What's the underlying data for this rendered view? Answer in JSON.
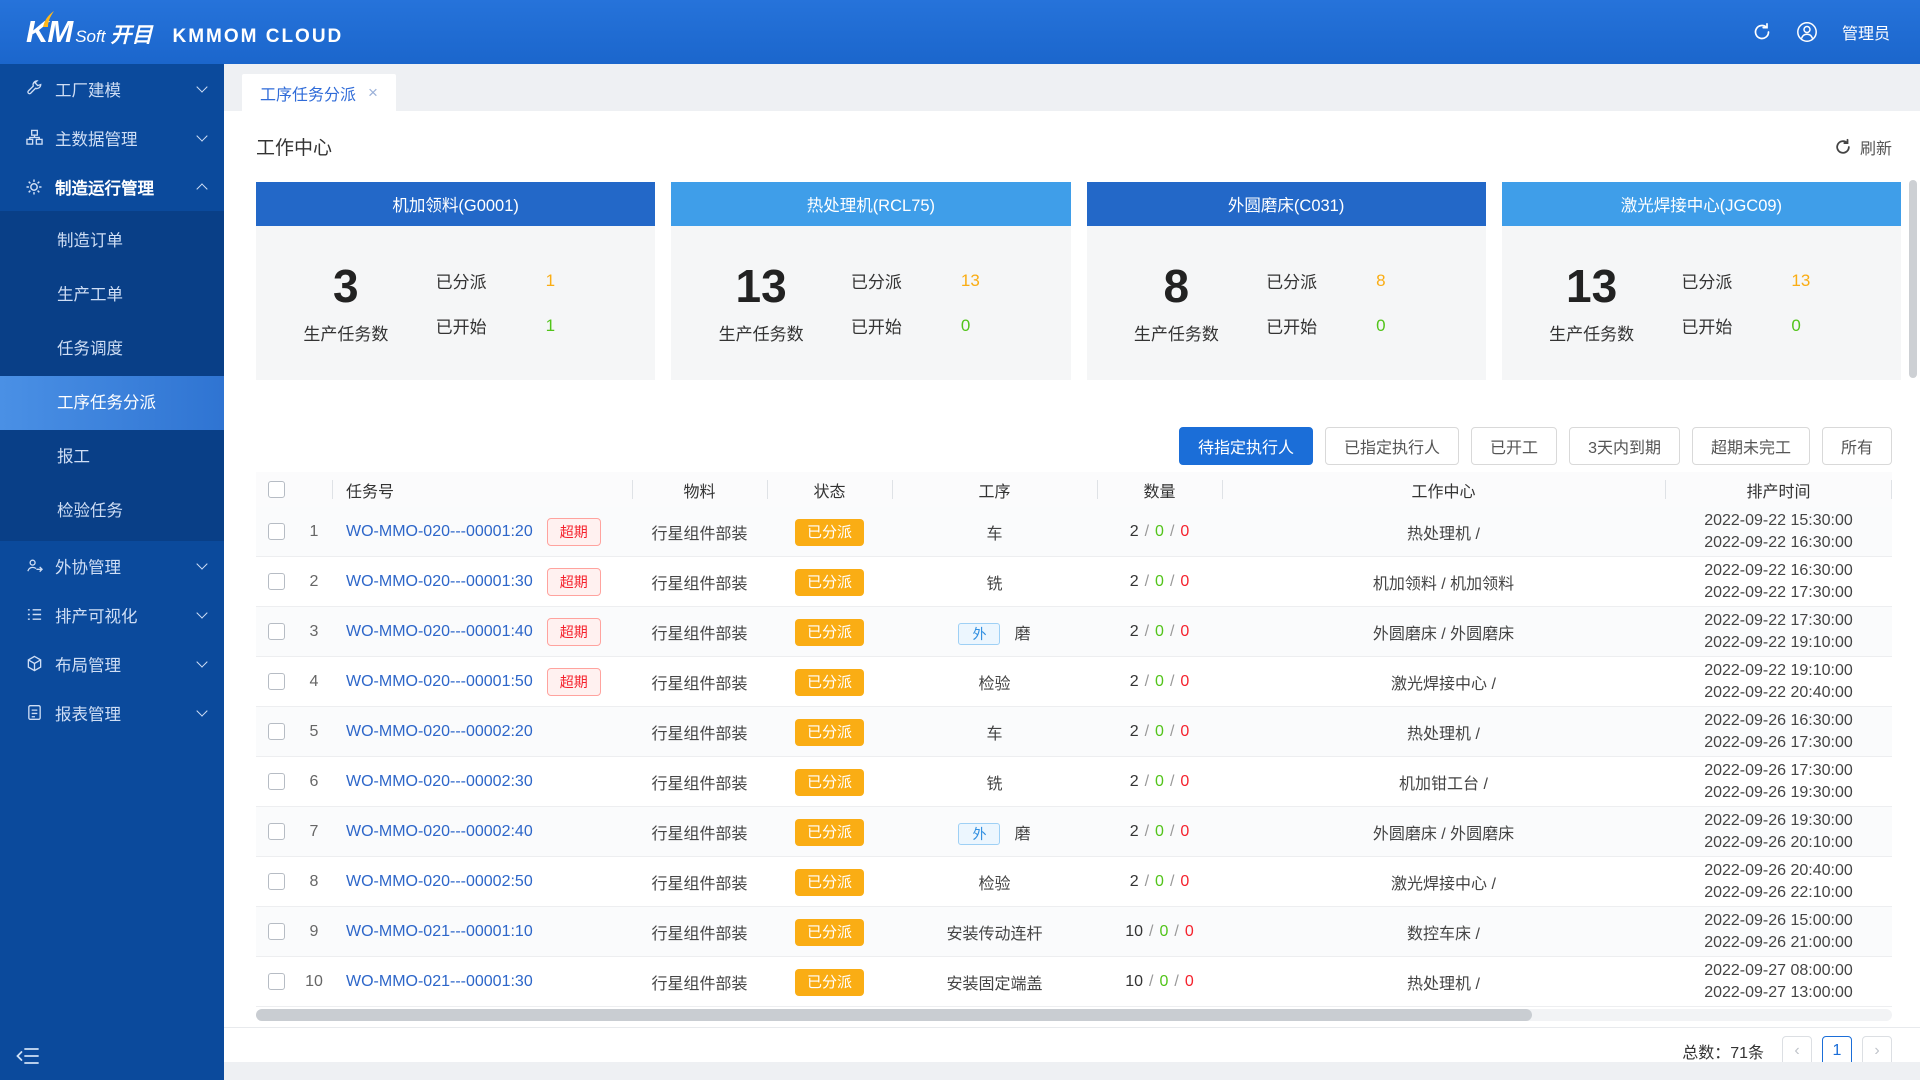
{
  "header": {
    "logo_km": "KM",
    "logo_soft": "Soft",
    "logo_kaimu": "开目",
    "brand": "KMMOM CLOUD",
    "user": "管理员"
  },
  "sidebar": {
    "items": [
      {
        "label": "工厂建模"
      },
      {
        "label": "主数据管理"
      },
      {
        "label": "制造运行管理",
        "children": [
          "制造订单",
          "生产工单",
          "任务调度",
          "工序任务分派",
          "报工",
          "检验任务"
        ]
      },
      {
        "label": "外协管理"
      },
      {
        "label": "排产可视化"
      },
      {
        "label": "布局管理"
      },
      {
        "label": "报表管理"
      }
    ]
  },
  "tab": {
    "label": "工序任务分派",
    "close_icon": "×"
  },
  "workcenter": {
    "title": "工作中心",
    "refresh_label": "刷新"
  },
  "cards": [
    {
      "name": "机加领料(G0001)",
      "total": "3",
      "total_label": "生产任务数",
      "assigned_label": "已分派",
      "assigned": "1",
      "started_label": "已开始",
      "started": "1"
    },
    {
      "name": "热处理机(RCL75)",
      "total": "13",
      "total_label": "生产任务数",
      "assigned_label": "已分派",
      "assigned": "13",
      "started_label": "已开始",
      "started": "0"
    },
    {
      "name": "外圆磨床(C031)",
      "total": "8",
      "total_label": "生产任务数",
      "assigned_label": "已分派",
      "assigned": "8",
      "started_label": "已开始",
      "started": "0"
    },
    {
      "name": "激光焊接中心(JGC09)",
      "total": "13",
      "total_label": "生产任务数",
      "assigned_label": "已分派",
      "assigned": "13",
      "started_label": "已开始",
      "started": "0"
    }
  ],
  "filters": [
    {
      "label": "待指定执行人"
    },
    {
      "label": "已指定执行人"
    },
    {
      "label": "已开工"
    },
    {
      "label": "3天内到期"
    },
    {
      "label": "超期未完工"
    },
    {
      "label": "所有"
    }
  ],
  "table": {
    "columns": {
      "task_no": "任务号",
      "material": "物料",
      "status": "状态",
      "process": "工序",
      "qty": "数量",
      "workcenter": "工作中心",
      "schedule": "排产时间"
    },
    "overdue_label": "超期",
    "outsource_tag": "外",
    "qty_sep": "/",
    "rows": [
      {
        "index": "1",
        "task_no": "WO-MMO-020---00001:20",
        "material": "行星组件部装",
        "status": "已分派",
        "process": "车",
        "qty_a": "2",
        "qty_b": "0",
        "qty_c": "0",
        "workcenter": "热处理机 /",
        "time_start": "2022-09-22 15:30:00",
        "time_end": "2022-09-22 16:30:00"
      },
      {
        "index": "2",
        "task_no": "WO-MMO-020---00001:30",
        "material": "行星组件部装",
        "status": "已分派",
        "process": "铣",
        "qty_a": "2",
        "qty_b": "0",
        "qty_c": "0",
        "workcenter": "机加领料 / 机加领料",
        "time_start": "2022-09-22 16:30:00",
        "time_end": "2022-09-22 17:30:00"
      },
      {
        "index": "3",
        "task_no": "WO-MMO-020---00001:40",
        "material": "行星组件部装",
        "status": "已分派",
        "process": "磨",
        "qty_a": "2",
        "qty_b": "0",
        "qty_c": "0",
        "workcenter": "外圆磨床 / 外圆磨床",
        "time_start": "2022-09-22 17:30:00",
        "time_end": "2022-09-22 19:10:00"
      },
      {
        "index": "4",
        "task_no": "WO-MMO-020---00001:50",
        "material": "行星组件部装",
        "status": "已分派",
        "process": "检验",
        "qty_a": "2",
        "qty_b": "0",
        "qty_c": "0",
        "workcenter": "激光焊接中心 /",
        "time_start": "2022-09-22 19:10:00",
        "time_end": "2022-09-22 20:40:00"
      },
      {
        "index": "5",
        "task_no": "WO-MMO-020---00002:20",
        "material": "行星组件部装",
        "status": "已分派",
        "process": "车",
        "qty_a": "2",
        "qty_b": "0",
        "qty_c": "0",
        "workcenter": "热处理机 /",
        "time_start": "2022-09-26 16:30:00",
        "time_end": "2022-09-26 17:30:00"
      },
      {
        "index": "6",
        "task_no": "WO-MMO-020---00002:30",
        "material": "行星组件部装",
        "status": "已分派",
        "process": "铣",
        "qty_a": "2",
        "qty_b": "0",
        "qty_c": "0",
        "workcenter": "机加钳工台 /",
        "time_start": "2022-09-26 17:30:00",
        "time_end": "2022-09-26 19:30:00"
      },
      {
        "index": "7",
        "task_no": "WO-MMO-020---00002:40",
        "material": "行星组件部装",
        "status": "已分派",
        "process": "磨",
        "qty_a": "2",
        "qty_b": "0",
        "qty_c": "0",
        "workcenter": "外圆磨床 / 外圆磨床",
        "time_start": "2022-09-26 19:30:00",
        "time_end": "2022-09-26 20:10:00"
      },
      {
        "index": "8",
        "task_no": "WO-MMO-020---00002:50",
        "material": "行星组件部装",
        "status": "已分派",
        "process": "检验",
        "qty_a": "2",
        "qty_b": "0",
        "qty_c": "0",
        "workcenter": "激光焊接中心 /",
        "time_start": "2022-09-26 20:40:00",
        "time_end": "2022-09-26 22:10:00"
      },
      {
        "index": "9",
        "task_no": "WO-MMO-021---00001:10",
        "material": "行星组件部装",
        "status": "已分派",
        "process": "安装传动连杆",
        "qty_a": "10",
        "qty_b": "0",
        "qty_c": "0",
        "workcenter": "数控车床 /",
        "time_start": "2022-09-26 15:00:00",
        "time_end": "2022-09-26 21:00:00"
      },
      {
        "index": "10",
        "task_no": "WO-MMO-021---00001:30",
        "material": "行星组件部装",
        "status": "已分派",
        "process": "安装固定端盖",
        "qty_a": "10",
        "qty_b": "0",
        "qty_c": "0",
        "workcenter": "热处理机 /",
        "time_start": "2022-09-27 08:00:00",
        "time_end": "2022-09-27 13:00:00"
      }
    ]
  },
  "footer": {
    "total_label": "总数：71条",
    "prev_icon": "‹",
    "page": "1",
    "next_icon": "›"
  }
}
